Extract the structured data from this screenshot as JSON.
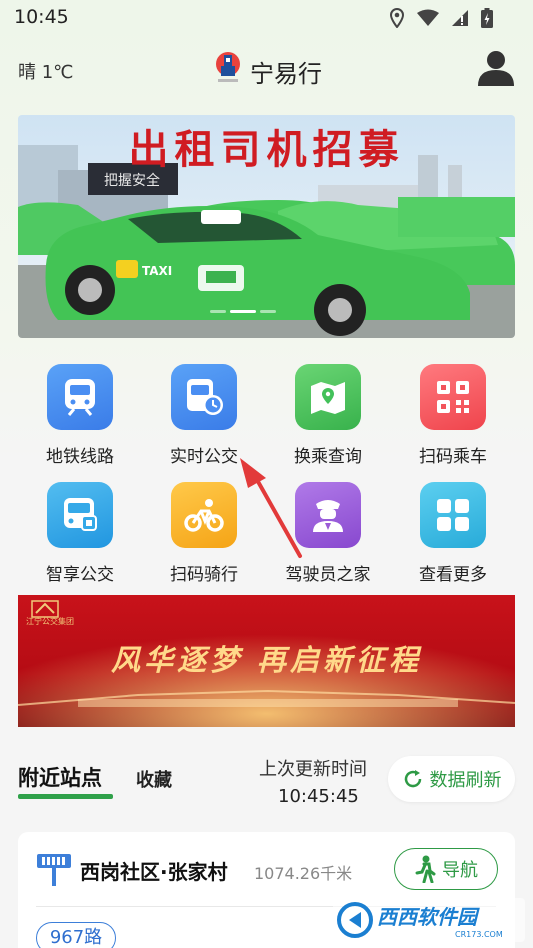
{
  "status_bar": {
    "time": "10:45",
    "icons": [
      "location-icon",
      "wifi-icon",
      "signal-icon",
      "battery-icon"
    ]
  },
  "header": {
    "weather": "晴 1℃",
    "title": "宁易行"
  },
  "banner_top": {
    "headline": "出租司机招募",
    "sign_text": "把握安全",
    "taxi_label": "TAXI",
    "slides": 3,
    "active_slide": 2
  },
  "services": [
    {
      "label": "地铁线路",
      "icon": "metro-icon",
      "color": "#4a8ef2"
    },
    {
      "label": "实时公交",
      "icon": "realtime-bus-icon",
      "color": "#4a8ef2"
    },
    {
      "label": "换乘查询",
      "icon": "map-icon",
      "color": "#43c15a"
    },
    {
      "label": "扫码乘车",
      "icon": "qr-code-icon",
      "color": "#f2545b"
    },
    {
      "label": "智享公交",
      "icon": "smart-bus-icon",
      "color": "#35a9e8"
    },
    {
      "label": "扫码骑行",
      "icon": "bicycle-icon",
      "color": "#f7b52b"
    },
    {
      "label": "驾驶员之家",
      "icon": "driver-icon",
      "color": "#9b5cd6"
    },
    {
      "label": "查看更多",
      "icon": "more-grid-icon",
      "color": "#3ab9e0"
    }
  ],
  "banner_mid": {
    "slogan": "风华逐梦  再启新征程",
    "brand": "江宁公交集团"
  },
  "nearby": {
    "tab_nearby": "附近站点",
    "tab_favorites": "收藏",
    "update_label": "上次更新时间",
    "update_time": "10:45:45",
    "refresh_label": "数据刷新",
    "stop_name": "西岗社区·张家村",
    "distance": "1074.26千米",
    "nav_label": "导航",
    "route": "967路"
  },
  "watermark": {
    "text": "西西软件园",
    "url": "CR173.COM"
  },
  "colors": {
    "accent_green": "#2e9a45",
    "route_blue": "#2f6fcf"
  }
}
